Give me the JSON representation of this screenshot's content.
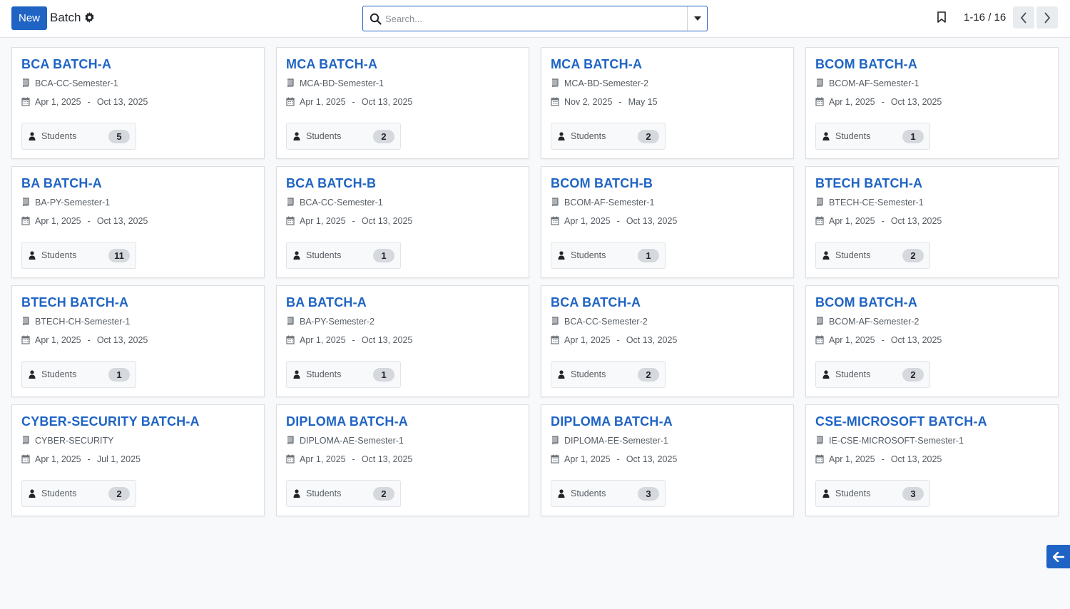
{
  "header": {
    "new_label": "New",
    "title": "Batch",
    "search_placeholder": "Search...",
    "pager": "1-16 / 16",
    "icons": [
      "gear-icon",
      "search-icon",
      "bookmark-icon",
      "chevron-left-icon",
      "chevron-right-icon"
    ]
  },
  "colors": {
    "accent": "#1f64c4",
    "badge": "#d5d8dc"
  },
  "students_label": "Students",
  "cards": [
    {
      "title": "BCA BATCH-A",
      "course": "BCA-CC-Semester-1",
      "start": "Apr 1, 2025",
      "end": "Oct 13, 2025",
      "students": "5"
    },
    {
      "title": "MCA BATCH-A",
      "course": "MCA-BD-Semester-1",
      "start": "Apr 1, 2025",
      "end": "Oct 13, 2025",
      "students": "2"
    },
    {
      "title": "MCA BATCH-A",
      "course": "MCA-BD-Semester-2",
      "start": "Nov 2, 2025",
      "end": "May 15",
      "students": "2"
    },
    {
      "title": "BCOM BATCH-A",
      "course": "BCOM-AF-Semester-1",
      "start": "Apr 1, 2025",
      "end": "Oct 13, 2025",
      "students": "1"
    },
    {
      "title": "BA BATCH-A",
      "course": "BA-PY-Semester-1",
      "start": "Apr 1, 2025",
      "end": "Oct 13, 2025",
      "students": "11"
    },
    {
      "title": "BCA BATCH-B",
      "course": "BCA-CC-Semester-1",
      "start": "Apr 1, 2025",
      "end": "Oct 13, 2025",
      "students": "1"
    },
    {
      "title": "BCOM BATCH-B",
      "course": "BCOM-AF-Semester-1",
      "start": "Apr 1, 2025",
      "end": "Oct 13, 2025",
      "students": "1"
    },
    {
      "title": "BTECH BATCH-A",
      "course": "BTECH-CE-Semester-1",
      "start": "Apr 1, 2025",
      "end": "Oct 13, 2025",
      "students": "2"
    },
    {
      "title": "BTECH BATCH-A",
      "course": "BTECH-CH-Semester-1",
      "start": "Apr 1, 2025",
      "end": "Oct 13, 2025",
      "students": "1"
    },
    {
      "title": "BA BATCH-A",
      "course": "BA-PY-Semester-2",
      "start": "Apr 1, 2025",
      "end": "Oct 13, 2025",
      "students": "1"
    },
    {
      "title": "BCA BATCH-A",
      "course": "BCA-CC-Semester-2",
      "start": "Apr 1, 2025",
      "end": "Oct 13, 2025",
      "students": "2"
    },
    {
      "title": "BCOM BATCH-A",
      "course": "BCOM-AF-Semester-2",
      "start": "Apr 1, 2025",
      "end": "Oct 13, 2025",
      "students": "2"
    },
    {
      "title": "CYBER-SECURITY BATCH-A",
      "course": "CYBER-SECURITY",
      "start": "Apr 1, 2025",
      "end": "Jul 1, 2025",
      "students": "2"
    },
    {
      "title": "DIPLOMA BATCH-A",
      "course": "DIPLOMA-AE-Semester-1",
      "start": "Apr 1, 2025",
      "end": "Oct 13, 2025",
      "students": "2"
    },
    {
      "title": "DIPLOMA BATCH-A",
      "course": "DIPLOMA-EE-Semester-1",
      "start": "Apr 1, 2025",
      "end": "Oct 13, 2025",
      "students": "3"
    },
    {
      "title": "CSE-MICROSOFT BATCH-A",
      "course": "IE-CSE-MICROSOFT-Semester-1",
      "start": "Apr 1, 2025",
      "end": "Oct 13, 2025",
      "students": "3"
    }
  ]
}
